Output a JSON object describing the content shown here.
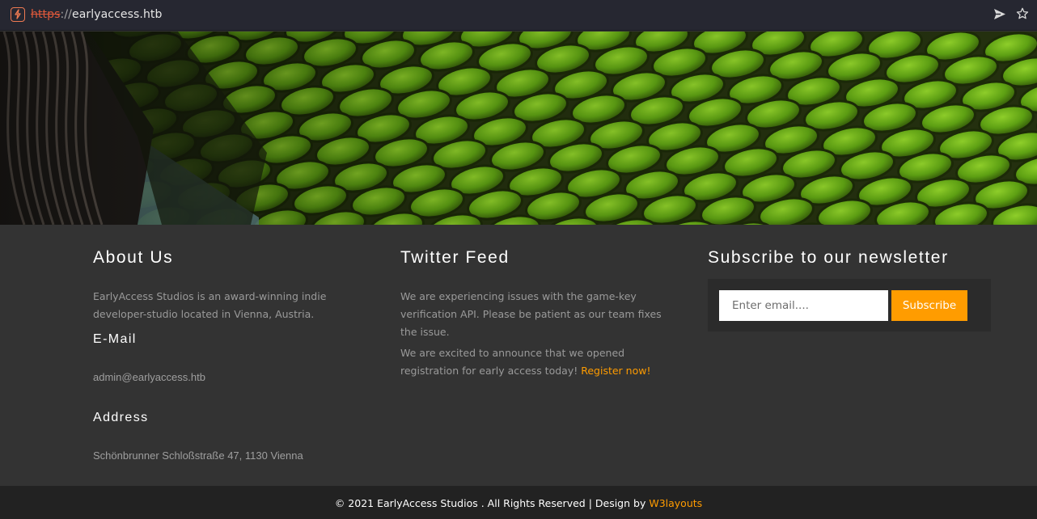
{
  "browser": {
    "url_protocol": "https",
    "url_separator": "://",
    "url_host": "earlyaccess.htb",
    "icons": [
      "site-icon",
      "send-icon",
      "bookmark-star-icon"
    ]
  },
  "hero": {
    "image": "green-reptile-scales-photo"
  },
  "about": {
    "title": "About Us",
    "text": "EarlyAccess Studios is an award-winning indie developer-studio located in Vienna, Austria.",
    "email_heading": "E-Mail",
    "email": "admin@earlyaccess.htb",
    "address_heading": "Address",
    "address": "Schönbrunner Schloßstraße 47, 1130 Vienna"
  },
  "twitter": {
    "title": "Twitter Feed",
    "tweet1": "We are experiencing issues with the game-key verification API. Please be patient as our team fixes the issue.",
    "tweet2": "We are excited to announce that we opened registration for early access today!",
    "tweet2_link": "Register now!"
  },
  "newsletter": {
    "title": "Subscribe to our newsletter",
    "email_placeholder": "Enter email....",
    "button_label": "Subscribe"
  },
  "footer": {
    "copyright": "© 2021 EarlyAccess Studios . All Rights Reserved | Design by",
    "design_link": "W3layouts"
  },
  "colors": {
    "accent": "#ff9c00",
    "background": "#333333",
    "bottom_bar": "#222222",
    "url_bar": "#262731",
    "protocol_strike": "#e0593b"
  }
}
